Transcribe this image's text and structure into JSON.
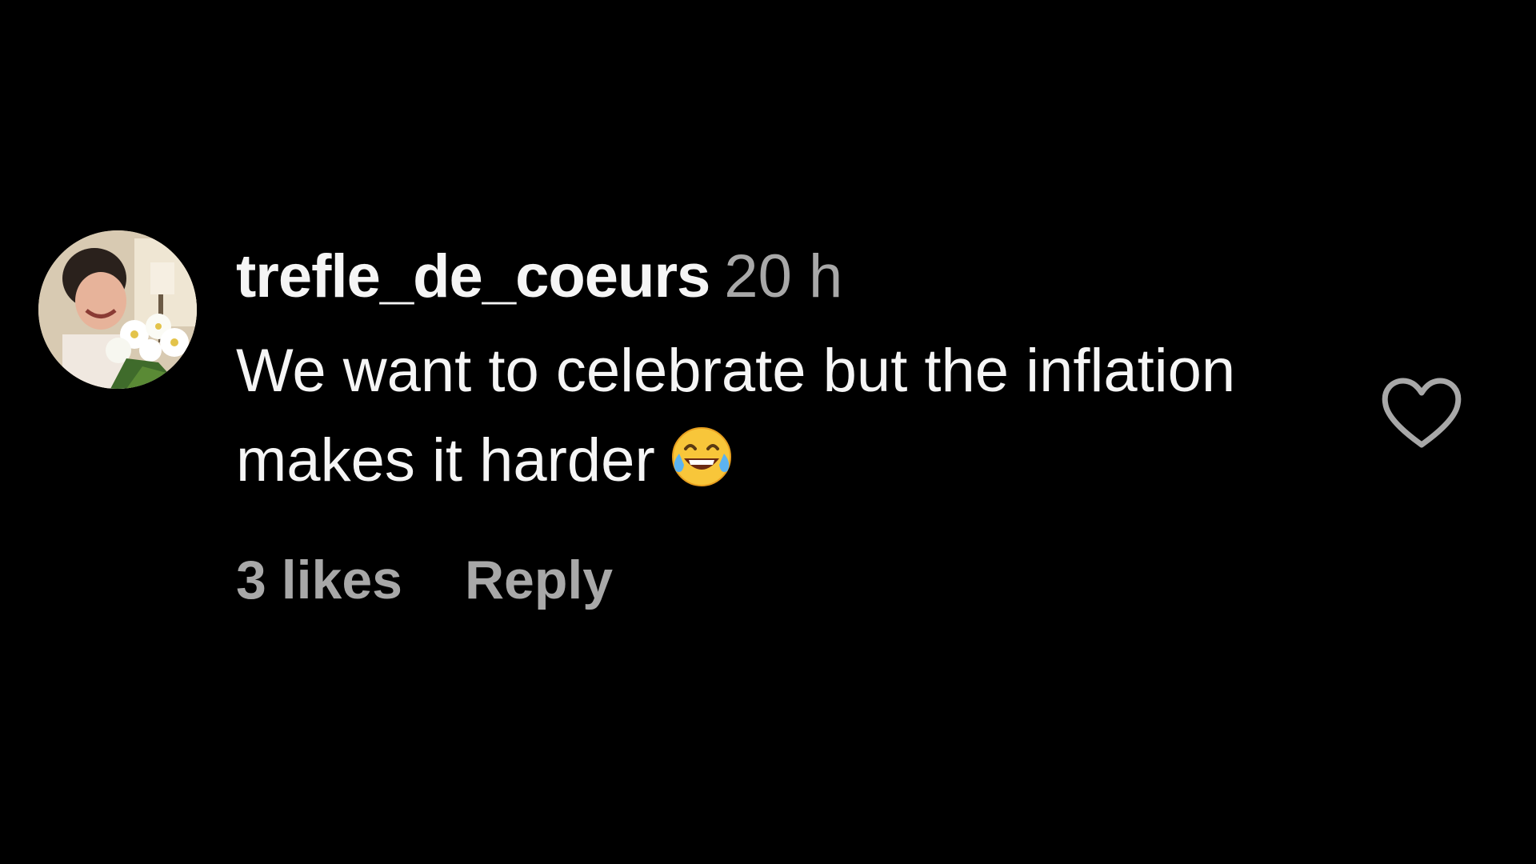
{
  "comment": {
    "username": "trefle_de_coeurs",
    "timestamp": "20 h",
    "text": "We want to celebrate but the inflation makes it harder",
    "emoji": "face-with-tears-of-joy",
    "likes_text": "3 likes",
    "reply_label": "Reply",
    "like_icon": "heart-outline-icon"
  },
  "colors": {
    "background": "#000000",
    "primary_text": "#f5f5f5",
    "secondary_text": "#a8a8a8"
  }
}
